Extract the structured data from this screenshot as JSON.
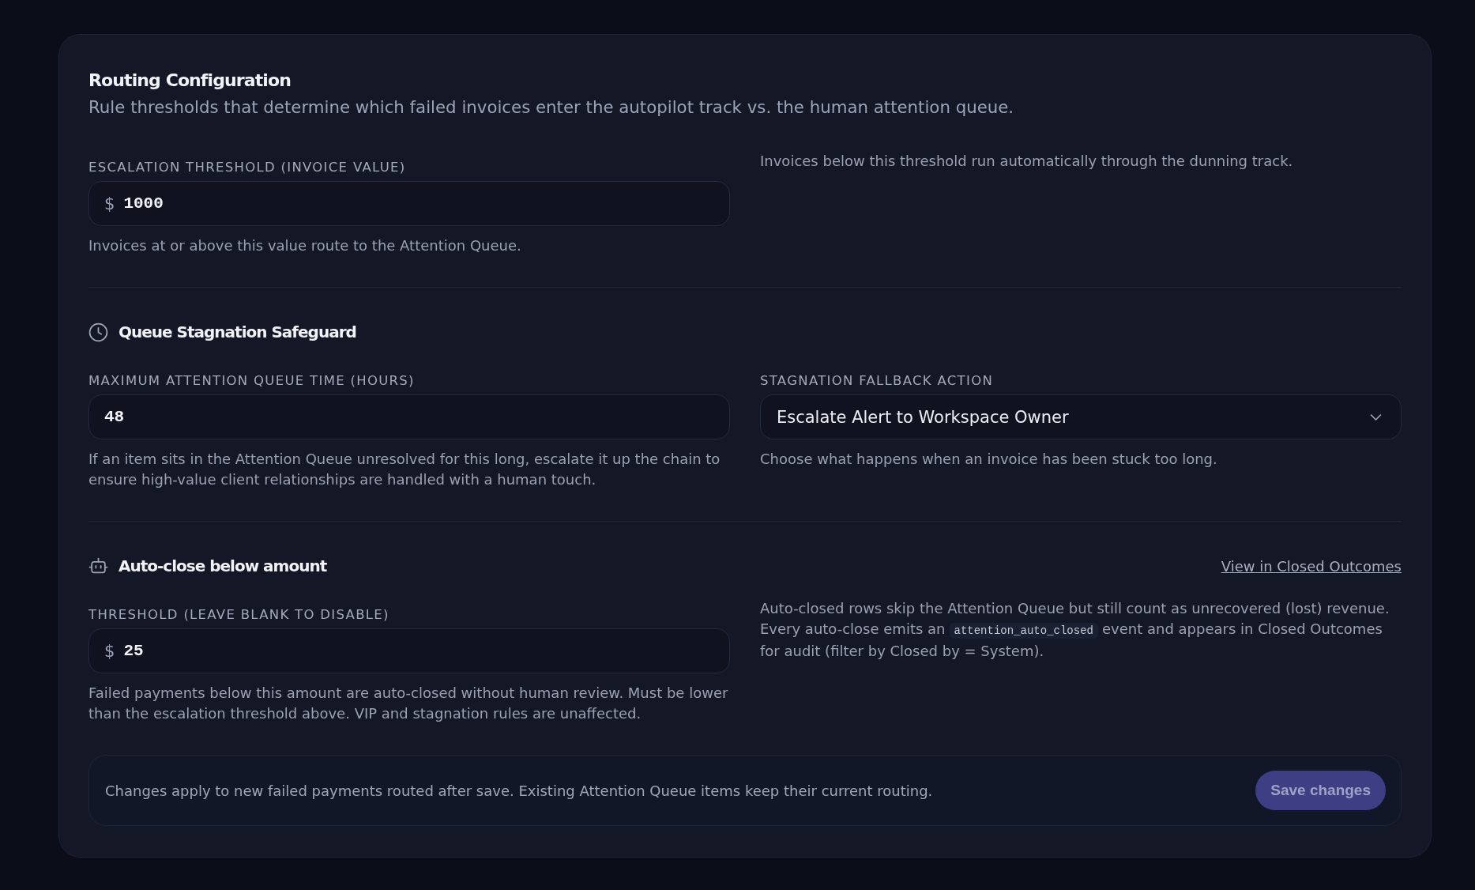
{
  "card": {
    "title": "Routing Configuration",
    "subtitle": "Rule thresholds that determine which failed invoices enter the autopilot track vs. the human attention queue."
  },
  "escalation": {
    "threshold": {
      "label": "ESCALATION THRESHOLD (INVOICE VALUE)",
      "prefix": "$",
      "value": "1000",
      "help": "Invoices at or above this value route to the Attention Queue."
    },
    "note": "Invoices below this threshold run automatically through the dunning track."
  },
  "stagnation": {
    "heading": "Queue Stagnation Safeguard",
    "max_time": {
      "label": "MAXIMUM ATTENTION QUEUE TIME (HOURS)",
      "value": "48",
      "help": "If an item sits in the Attention Queue unresolved for this long, escalate it up the chain to ensure high-value client relationships are handled with a human touch."
    },
    "fallback_action": {
      "label": "STAGNATION FALLBACK ACTION",
      "value": "Escalate Alert to Workspace Owner",
      "help": "Choose what happens when an invoice has been stuck too long."
    }
  },
  "auto_close": {
    "heading": "Auto-close below amount",
    "link": "View in Closed Outcomes",
    "threshold": {
      "label": "THRESHOLD (LEAVE BLANK TO DISABLE)",
      "prefix": "$",
      "value": "25",
      "help": "Failed payments below this amount are auto-closed without human review. Must be lower than the escalation threshold above. VIP and stagnation rules are unaffected."
    },
    "note": [
      {
        "kind": "text",
        "text": "Auto-closed rows skip the Attention Queue but still count as unrecovered (lost) revenue. Every auto-close emits an"
      },
      {
        "kind": "code",
        "text": "attention_auto_closed"
      },
      {
        "kind": "text",
        "text": "event and appears in Closed Outcomes for audit (filter by Closed by = System)."
      }
    ]
  },
  "footer": {
    "text": "Changes apply to new failed payments routed after save. Existing Attention Queue items keep their current routing.",
    "save_button": {
      "label": "Save changes",
      "disabled": true
    }
  }
}
